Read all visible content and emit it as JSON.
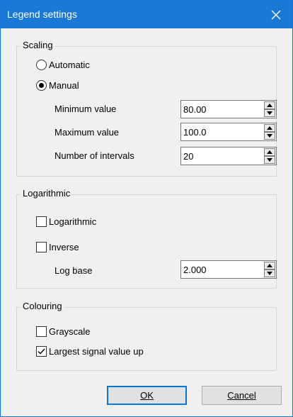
{
  "window": {
    "title": "Legend settings"
  },
  "scaling": {
    "group_label": "Scaling",
    "automatic_label": "Automatic",
    "manual_label": "Manual",
    "selected": "manual",
    "minimum_label": "Minimum value",
    "minimum_value": "80.00",
    "maximum_label": "Maximum value",
    "maximum_value": "100.0",
    "intervals_label": "Number of intervals",
    "intervals_value": "20"
  },
  "logarithmic": {
    "group_label": "Logarithmic",
    "logarithmic_label": "Logarithmic",
    "logarithmic_checked": false,
    "inverse_label": "Inverse",
    "inverse_checked": false,
    "log_base_label": "Log base",
    "log_base_value": "2.000"
  },
  "colouring": {
    "group_label": "Colouring",
    "grayscale_label": "Grayscale",
    "grayscale_checked": false,
    "largest_up_label": "Largest signal value up",
    "largest_up_checked": true
  },
  "buttons": {
    "ok_label": "OK",
    "cancel_label": "Cancel"
  },
  "icons": {
    "close": "close-icon",
    "spin_up": "arrow-up-icon",
    "spin_down": "arrow-down-icon",
    "check": "checkmark-icon"
  },
  "colors": {
    "titlebar": "#1a78d7",
    "window_bg": "#f0f0f0",
    "default_button_border": "#0078d7"
  }
}
